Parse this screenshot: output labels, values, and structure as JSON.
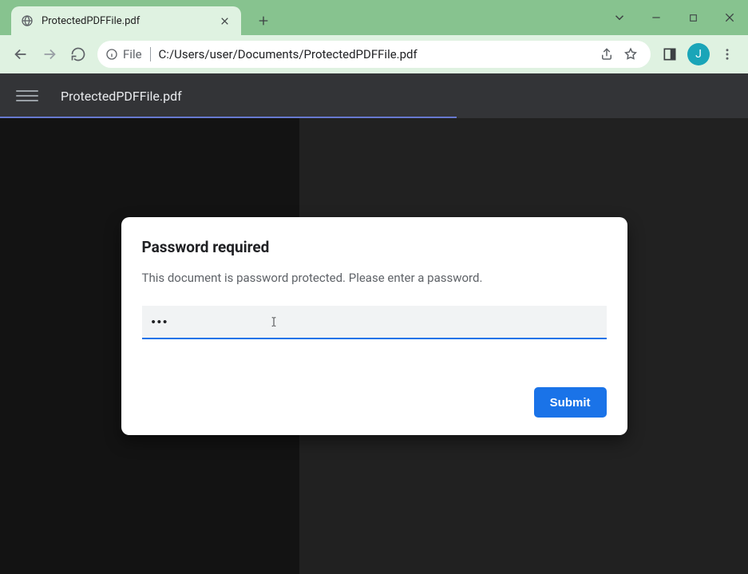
{
  "browser": {
    "tab": {
      "title": "ProtectedPDFFile.pdf"
    },
    "omnibox": {
      "origin_label": "File",
      "url": "C:/Users/user/Documents/ProtectedPDFFile.pdf"
    },
    "avatar_initial": "J"
  },
  "pdf_viewer": {
    "filename": "ProtectedPDFFile.pdf"
  },
  "dialog": {
    "title": "Password required",
    "message": "This document is password protected. Please enter a password.",
    "password_value": "•••",
    "submit_label": "Submit"
  }
}
